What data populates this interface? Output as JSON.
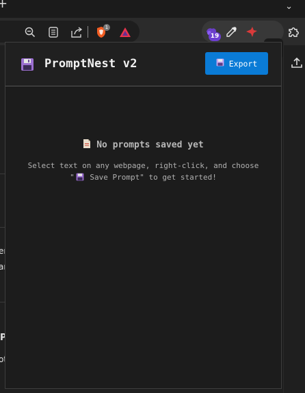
{
  "browser": {
    "new_tab_glyph": "+",
    "tab_list_glyph": "⌄",
    "brave_badge_count": "1",
    "extension_badge_count": "19",
    "pinned_extension_letter": "P"
  },
  "page": {
    "partial_text": [
      "er",
      "ar",
      "P",
      "ot"
    ]
  },
  "popup": {
    "title": "PromptNest v2",
    "export_label": "Export",
    "empty_title": "No prompts saved yet",
    "empty_desc_before": "Select text on any webpage, right-click, and choose \"",
    "empty_desc_action": "Save Prompt",
    "empty_desc_after": "\" to get started!"
  },
  "colors": {
    "accent": "#0a7bd6",
    "popup_bg": "#1c1c1c",
    "floppy": "#9b6fd0"
  },
  "icons": [
    "zoom-out-icon",
    "reader-mode-icon",
    "share-icon",
    "brave-shields-icon",
    "brave-rewards-icon",
    "extension-icon",
    "eyedropper-icon",
    "red-bird-icon",
    "promptnest-extension-icon",
    "puzzle-icon",
    "floppy-disk-icon",
    "page-icon",
    "upload-icon"
  ]
}
